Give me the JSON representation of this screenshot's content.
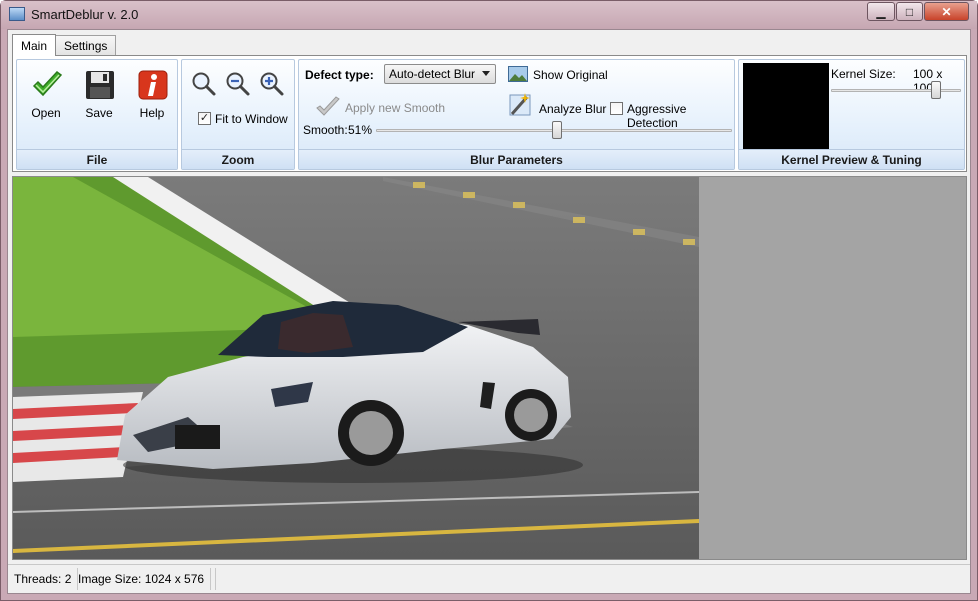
{
  "window": {
    "title": "SmartDeblur v. 2.0",
    "min_glyph": "▁",
    "max_glyph": "□",
    "close_glyph": "✕"
  },
  "tabs": [
    {
      "label": "Main",
      "active": true
    },
    {
      "label": "Settings",
      "active": false
    }
  ],
  "file_group": {
    "caption": "File",
    "open_label": "Open",
    "save_label": "Save",
    "help_label": "Help"
  },
  "zoom_group": {
    "caption": "Zoom",
    "fit_to_window_label": "Fit to Window",
    "fit_to_window_checked": true,
    "check_glyph": "✓"
  },
  "blur_group": {
    "caption": "Blur Parameters",
    "defect_type_label": "Defect type:",
    "defect_type_value": "Auto-detect Blur",
    "show_original_label": "Show Original",
    "apply_smooth_label": "Apply new Smooth",
    "analyze_blur_label": "Analyze Blur",
    "aggressive_detection_label": "Aggressive Detection",
    "aggressive_detection_checked": false,
    "smooth_label": "Smooth:",
    "smooth_value_text": "51%",
    "smooth_value": 51
  },
  "kernel_group": {
    "caption": "Kernel Preview & Tuning",
    "kernel_size_label": "Kernel Size:",
    "kernel_size_value": "100 x 100"
  },
  "status": {
    "threads": "Threads: 2",
    "image_size": "Image Size: 1024 x 576"
  },
  "colors": {
    "ribbon_accent": "#d7e7f8",
    "window_frame": "#c9a9b5",
    "close_red": "#c8432a"
  }
}
